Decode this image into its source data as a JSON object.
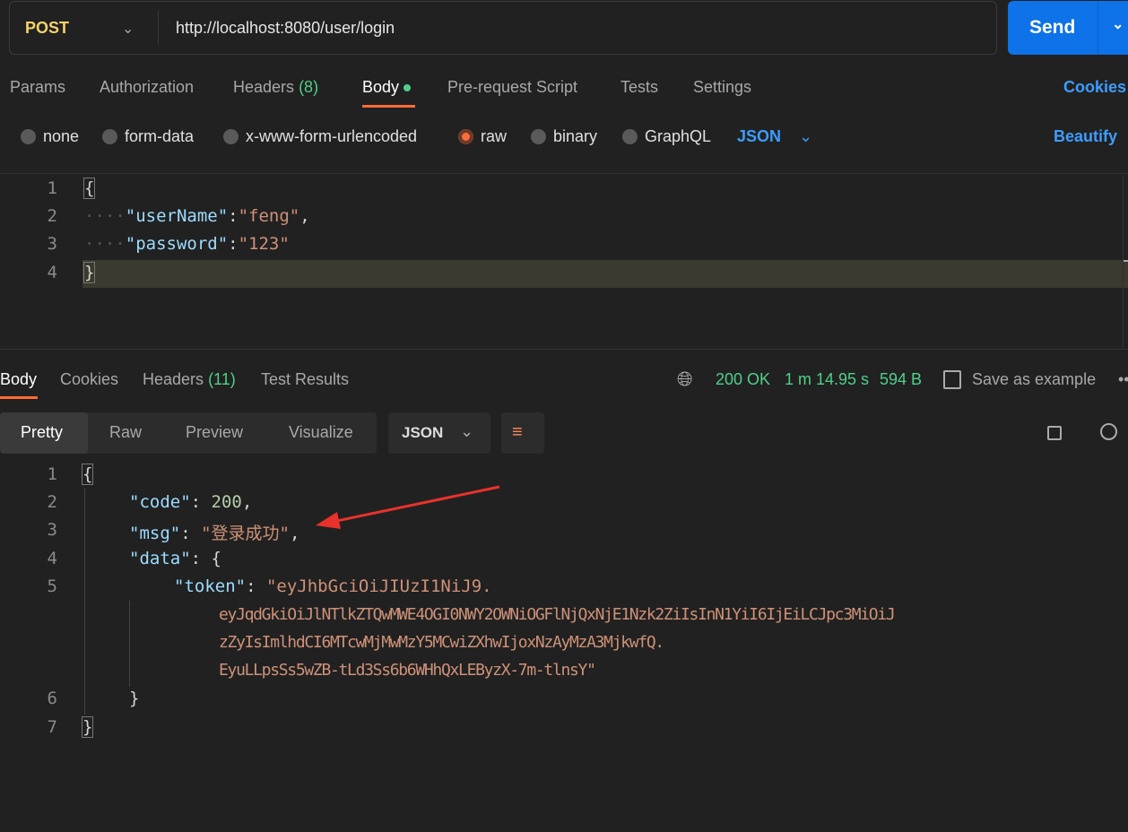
{
  "request": {
    "method": "POST",
    "url": "http://localhost:8080/user/login",
    "send_label": "Send"
  },
  "tabs": [
    {
      "label": "Params"
    },
    {
      "label": "Authorization"
    },
    {
      "label": "Headers",
      "count": "(8)"
    },
    {
      "label": "Body"
    },
    {
      "label": "Pre-request Script"
    },
    {
      "label": "Tests"
    },
    {
      "label": "Settings"
    }
  ],
  "cookies_link": "Cookies",
  "body_types": [
    "none",
    "form-data",
    "x-www-form-urlencoded",
    "raw",
    "binary",
    "GraphQL"
  ],
  "selected_body_type": "raw",
  "format": "JSON",
  "beautify": "Beautify",
  "request_body": {
    "line_numbers": [
      "1",
      "2",
      "3",
      "4"
    ],
    "open": "{",
    "k1": "\"userName\"",
    "v1": "\"feng\"",
    "k2": "\"password\"",
    "v2": "\"123\"",
    "close": "}"
  },
  "response_tabs": [
    {
      "label": "Body"
    },
    {
      "label": "Cookies"
    },
    {
      "label": "Headers",
      "count": "(11)"
    },
    {
      "label": "Test Results"
    }
  ],
  "status": {
    "code": "200 OK",
    "time": "1 m 14.95 s",
    "size": "594 B",
    "save": "Save as example"
  },
  "view_modes": [
    "Pretty",
    "Raw",
    "Preview",
    "Visualize"
  ],
  "response_format": "JSON",
  "response_body": {
    "line_numbers": [
      "1",
      "2",
      "3",
      "4",
      "5",
      "6",
      "7"
    ],
    "open": "{",
    "code_key": "\"code\"",
    "code_val": "200",
    "msg_key": "\"msg\"",
    "msg_val": "\"登录成功\"",
    "data_key": "\"data\"",
    "token_key": "\"token\"",
    "token_lines": [
      "\"eyJhbGciOiJIUzI1NiJ9.",
      "eyJqdGkiOiJlNTlkZTQwMWE4OGI0NWY2OWNiOGFlNjQxNjE1Nzk2ZiIsInN1YiI6IjEiLCJpc3MiOiJ",
      "zZyIsImlhdCI6MTcwMjMwMzY5MCwiZXhwIjoxNzAyMzA3MjkwfQ.",
      "EyuLLpsSs5wZB-tLd3Ss6b6WHhQxLEByzX-7m-tlnsY\""
    ],
    "close_inner": "}",
    "close": "}"
  },
  "colors": {
    "accent": "#ff6c37",
    "send": "#0e72e8",
    "success": "#4fd08a",
    "annotation_arrow": "#e8322c"
  }
}
